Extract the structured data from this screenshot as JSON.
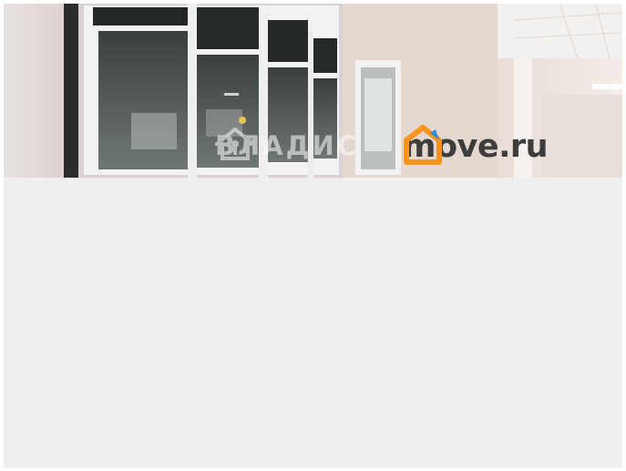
{
  "photo": {
    "description_hidden": false,
    "watermarks": {
      "vladis": {
        "text": "ВЛАДИС",
        "icon": "house-key-icon"
      },
      "move": {
        "text": "move.ru",
        "icon": "house-outline-icon",
        "accent": "#f7941d"
      }
    }
  },
  "colors": {
    "placeholder": "#efefef",
    "wall": "#cfc6c3",
    "window_dark": "#2a2f2e"
  }
}
